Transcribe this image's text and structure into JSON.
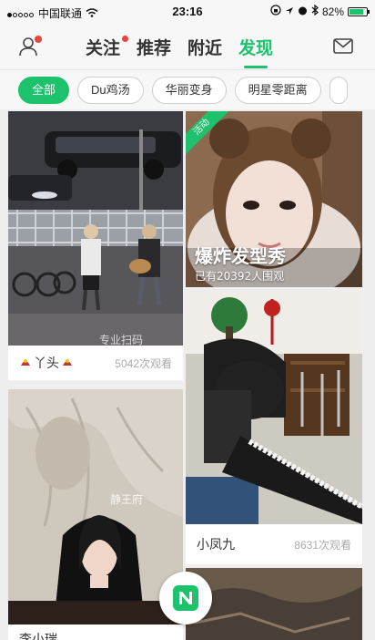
{
  "status_bar": {
    "carrier": "中国联通",
    "time": "23:16",
    "battery": "82%"
  },
  "nav": {
    "tabs": [
      {
        "label": "关注",
        "has_dot": true
      },
      {
        "label": "推荐"
      },
      {
        "label": "附近"
      },
      {
        "label": "发现",
        "active": true
      }
    ]
  },
  "filters": [
    "全部",
    "Du鸡汤",
    "华丽变身",
    "明星零距离"
  ],
  "cards": [
    {
      "name": "丫头",
      "views": "5042次观看",
      "watermark": "专业扫码"
    },
    {
      "ribbon": "活动",
      "title": "爆炸发型秀",
      "subtitle": "已有20392人围观"
    },
    {
      "name": "小凤九",
      "views": "8631次观看"
    },
    {
      "watermark": "静王府",
      "name": "李小瑞"
    }
  ],
  "colors": {
    "accent": "#1ec26c",
    "badge": "#e8453c"
  }
}
